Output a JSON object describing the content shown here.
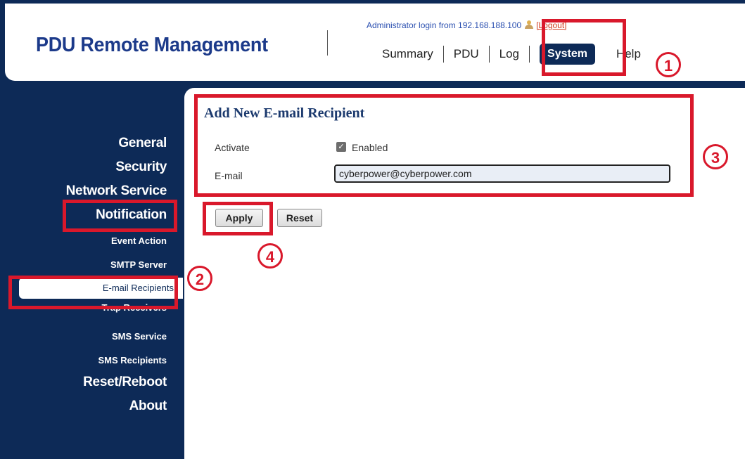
{
  "header": {
    "title": "PDU Remote Management",
    "login_text": "Administrator login from 192.168.188.100",
    "logout_label": "[Logout]",
    "nav": {
      "summary": "Summary",
      "pdu": "PDU",
      "log": "Log",
      "system": "System",
      "help": "Help"
    }
  },
  "sidebar": {
    "general": "General",
    "security": "Security",
    "network_service": "Network Service",
    "notification": "Notification",
    "event_action": "Event Action",
    "smtp_server": "SMTP Server",
    "email_recipients": "E-mail Recipients",
    "trap_receivers": "Trap Receivers",
    "sms_service": "SMS Service",
    "sms_recipients": "SMS Recipients",
    "reset_reboot": "Reset/Reboot",
    "about": "About"
  },
  "form": {
    "title": "Add New E-mail Recipient",
    "activate_label": "Activate",
    "enabled_label": "Enabled",
    "enabled": true,
    "email_label": "E-mail",
    "email_value": "cyberpower@cyberpower.com",
    "apply_label": "Apply",
    "reset_label": "Reset"
  },
  "annotations": {
    "step1": "1",
    "step2": "2",
    "step3": "3",
    "step4": "4",
    "color": "#d9182b"
  }
}
